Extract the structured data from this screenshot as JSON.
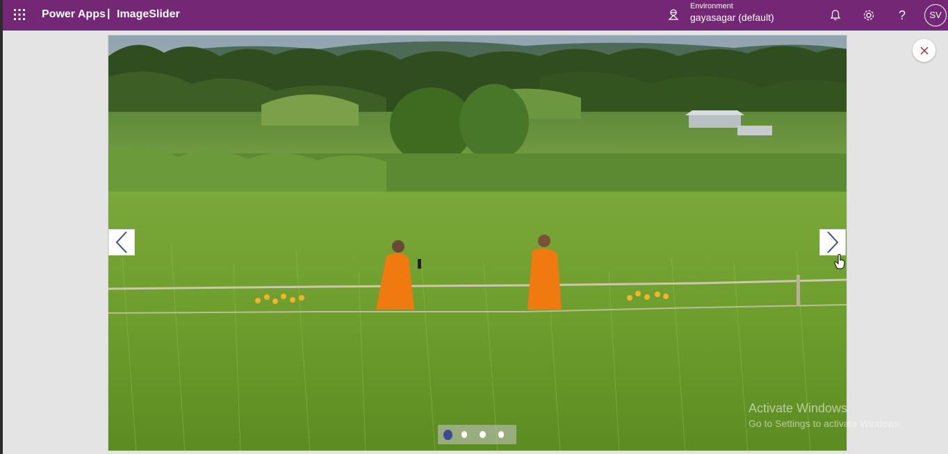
{
  "header": {
    "brand": "Power Apps",
    "separator": "|",
    "app_name": "ImageSlider",
    "environment_label": "Environment",
    "environment_value": "gayasagar (default)",
    "help_glyph": "?",
    "avatar_initials": "SV",
    "icons": [
      "waffle-icon",
      "environment-icon",
      "bell-icon",
      "gear-icon",
      "help-icon"
    ],
    "color": "#742774"
  },
  "slider": {
    "dots_total": 4,
    "active_dot": 1,
    "active_dot_color": "#3b4a93",
    "prev_icon": "chevron-left-icon",
    "next_icon": "chevron-right-icon",
    "close_icon": "close-icon"
  },
  "watermark": {
    "title": "Activate Windows",
    "subtitle": "Go to Settings to activate Windows."
  }
}
